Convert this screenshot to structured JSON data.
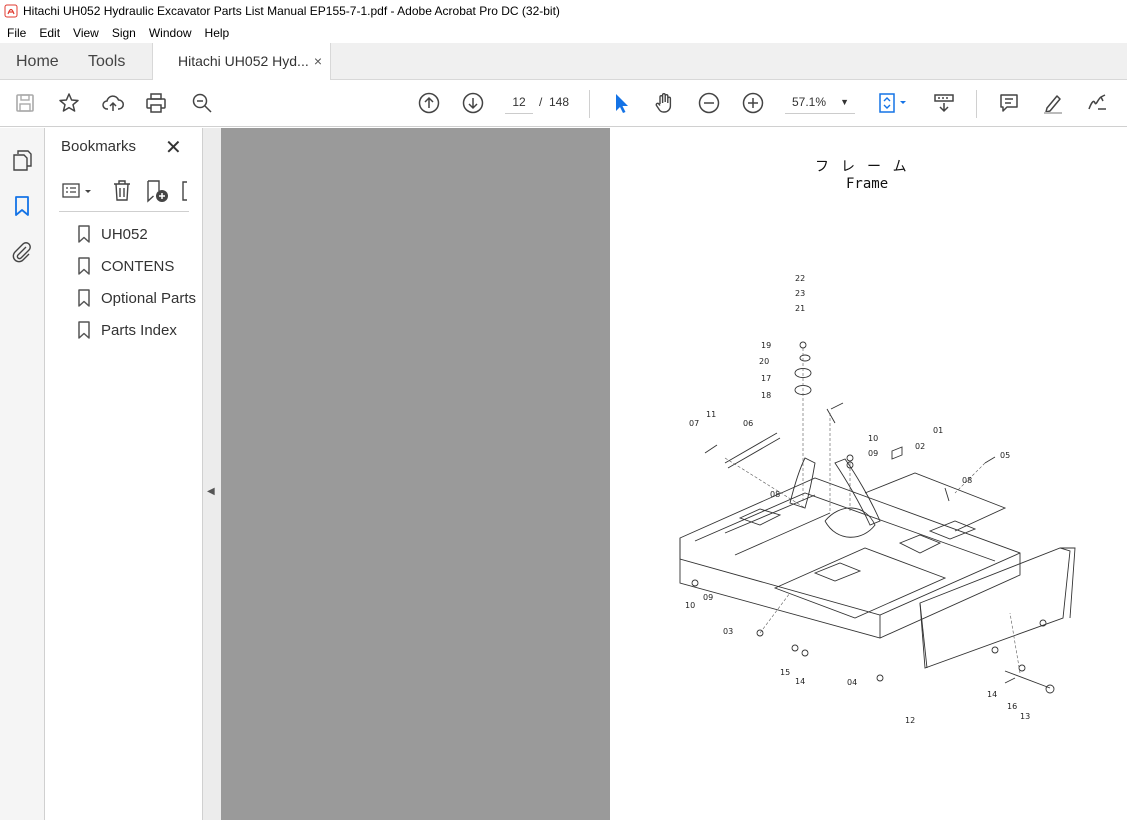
{
  "window": {
    "title": "Hitachi UH052 Hydraulic Excavator Parts List Manual EP155-7-1.pdf - Adobe Acrobat Pro DC (32-bit)"
  },
  "menu": [
    "File",
    "Edit",
    "View",
    "Sign",
    "Window",
    "Help"
  ],
  "tabs": {
    "home": "Home",
    "tools": "Tools",
    "document": "Hitachi UH052 Hyd...",
    "close": "×"
  },
  "toolbar": {
    "page_current": "12",
    "page_separator": "/",
    "page_total": "148",
    "zoom": "57.1%"
  },
  "bookmarks": {
    "title": "Bookmarks",
    "close": "✕",
    "items": [
      {
        "label": "UH052"
      },
      {
        "label": "CONTENS"
      },
      {
        "label": "Optional Parts"
      },
      {
        "label": "Parts Index"
      }
    ]
  },
  "document": {
    "title_jp": "フレーム",
    "title_en": "Frame",
    "part_numbers": [
      "22",
      "23",
      "21",
      "19",
      "20",
      "17",
      "18",
      "11",
      "07",
      "06",
      "10",
      "09",
      "02",
      "01",
      "05",
      "08",
      "08",
      "10",
      "09",
      "03",
      "15",
      "14",
      "04",
      "12",
      "14",
      "16",
      "13"
    ]
  },
  "colors": {
    "accent": "#1473e6",
    "canvas_bg": "#9a9a9a"
  }
}
